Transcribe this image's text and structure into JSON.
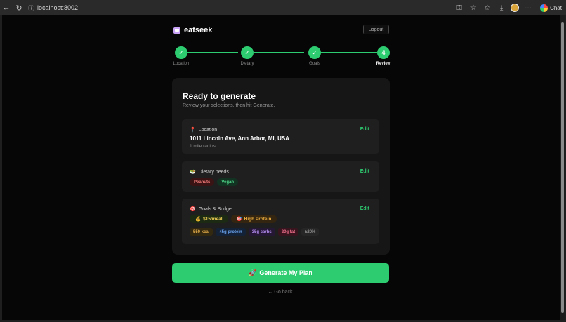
{
  "browser": {
    "url": "localhost:8002",
    "chat_label": "Chat"
  },
  "app": {
    "brand": "eatseek",
    "logout_label": "Logout"
  },
  "stepper": {
    "steps": [
      {
        "symbol": "✓",
        "label": "Location"
      },
      {
        "symbol": "✓",
        "label": "Dietary"
      },
      {
        "symbol": "✓",
        "label": "Goals"
      },
      {
        "symbol": "4",
        "label": "Review"
      }
    ]
  },
  "review": {
    "title": "Ready to generate",
    "subtitle": "Review your selections, then hit Generate.",
    "edit_label": "Edit",
    "location": {
      "icon": "📍",
      "heading": "Location",
      "address": "1011 Lincoln Ave, Ann Arbor, MI, USA",
      "radius": "1 mile radius"
    },
    "dietary": {
      "icon": "🥗",
      "heading": "Dietary needs",
      "tags": [
        "Peanuts",
        "Vegan"
      ]
    },
    "goals": {
      "icon": "🎯",
      "heading": "Goals & Budget",
      "budget": "$15/meal",
      "budget_icon": "💰",
      "goal": "High Protein",
      "goal_icon": "🎯",
      "macros": [
        "550 kcal",
        "45g protein",
        "35g carbs",
        "20g fat",
        "±20%"
      ]
    }
  },
  "actions": {
    "generate_label": "Generate My Plan",
    "generate_icon": "🚀",
    "back_label": "← Go back"
  },
  "colors": {
    "accent": "#2ecc71",
    "background": "#060606",
    "card": "#161616"
  }
}
